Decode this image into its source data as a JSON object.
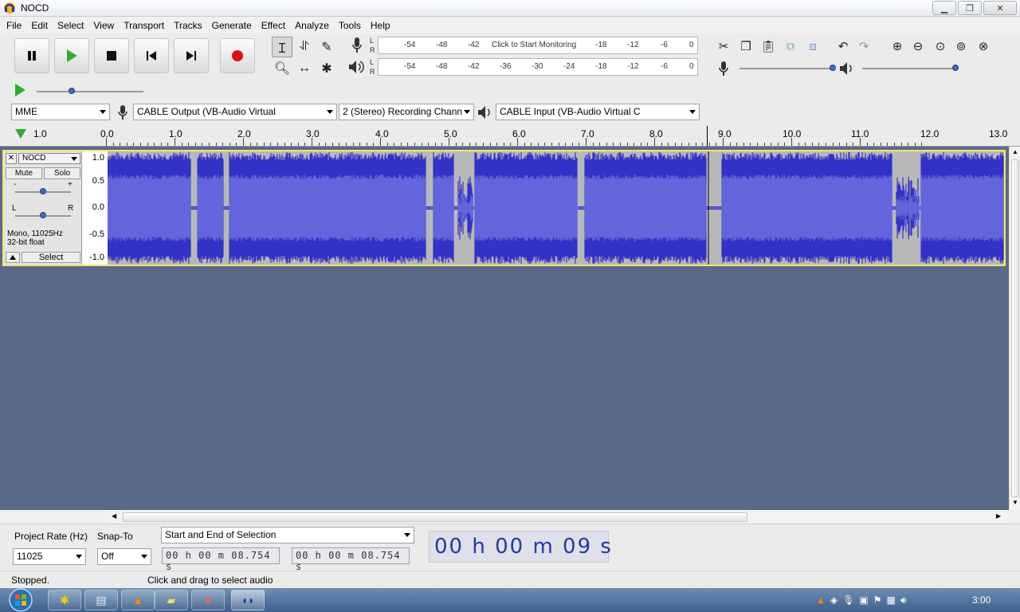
{
  "window": {
    "title": "NOCD"
  },
  "menu": [
    "File",
    "Edit",
    "Select",
    "View",
    "Transport",
    "Tracks",
    "Generate",
    "Effect",
    "Analyze",
    "Tools",
    "Help"
  ],
  "meters": {
    "record_ticks": [
      "-54",
      "-48",
      "-42",
      "-18",
      "-12",
      "-6",
      "0"
    ],
    "record_hint": "Click to Start Monitoring",
    "play_ticks": [
      "-54",
      "-48",
      "-42",
      "-36",
      "-30",
      "-24",
      "-18",
      "-12",
      "-6",
      "0"
    ],
    "channel_l": "L",
    "channel_r": "R"
  },
  "devices": {
    "host": "MME",
    "input_device": "CABLE Output (VB-Audio Virtual",
    "channels": "2 (Stereo) Recording Chann",
    "output_device": "CABLE Input (VB-Audio Virtual C"
  },
  "ruler": {
    "labels": [
      "1.0",
      "0.0",
      "1.0",
      "2.0",
      "3.0",
      "4.0",
      "5.0",
      "6.0",
      "7.0",
      "8.0",
      "9.0",
      "10.0",
      "11.0",
      "12.0",
      "13.0"
    ]
  },
  "track": {
    "name": "NOCD",
    "mute": "Mute",
    "solo": "Solo",
    "gain_minus": "-",
    "gain_plus": "+",
    "pan_l": "L",
    "pan_r": "R",
    "info_line1": "Mono, 11025Hz",
    "info_line2": "32-bit float",
    "select": "Select",
    "scale": [
      "1.0",
      "0.5",
      "0.0",
      "-0.5",
      "-1.0"
    ]
  },
  "selection_toolbar": {
    "project_rate_label": "Project Rate (Hz)",
    "project_rate_value": "11025",
    "snap_to_label": "Snap-To",
    "snap_to_value": "Off",
    "mode": "Start and End of Selection",
    "start_time": "00 h 00 m 08.754 s",
    "end_time": "00 h 00 m 08.754 s",
    "audio_position": "00 h 00 m 09 s"
  },
  "status": {
    "state": "Stopped.",
    "hint": "Click and drag to select audio"
  },
  "taskbar": {
    "clock": "3:00"
  },
  "colors": {
    "wave_blue": "#3232c8",
    "wave_light": "#6464dc",
    "track_bg": "#5a6a86",
    "record_red": "#e01010",
    "play_green": "#2fae2f"
  }
}
